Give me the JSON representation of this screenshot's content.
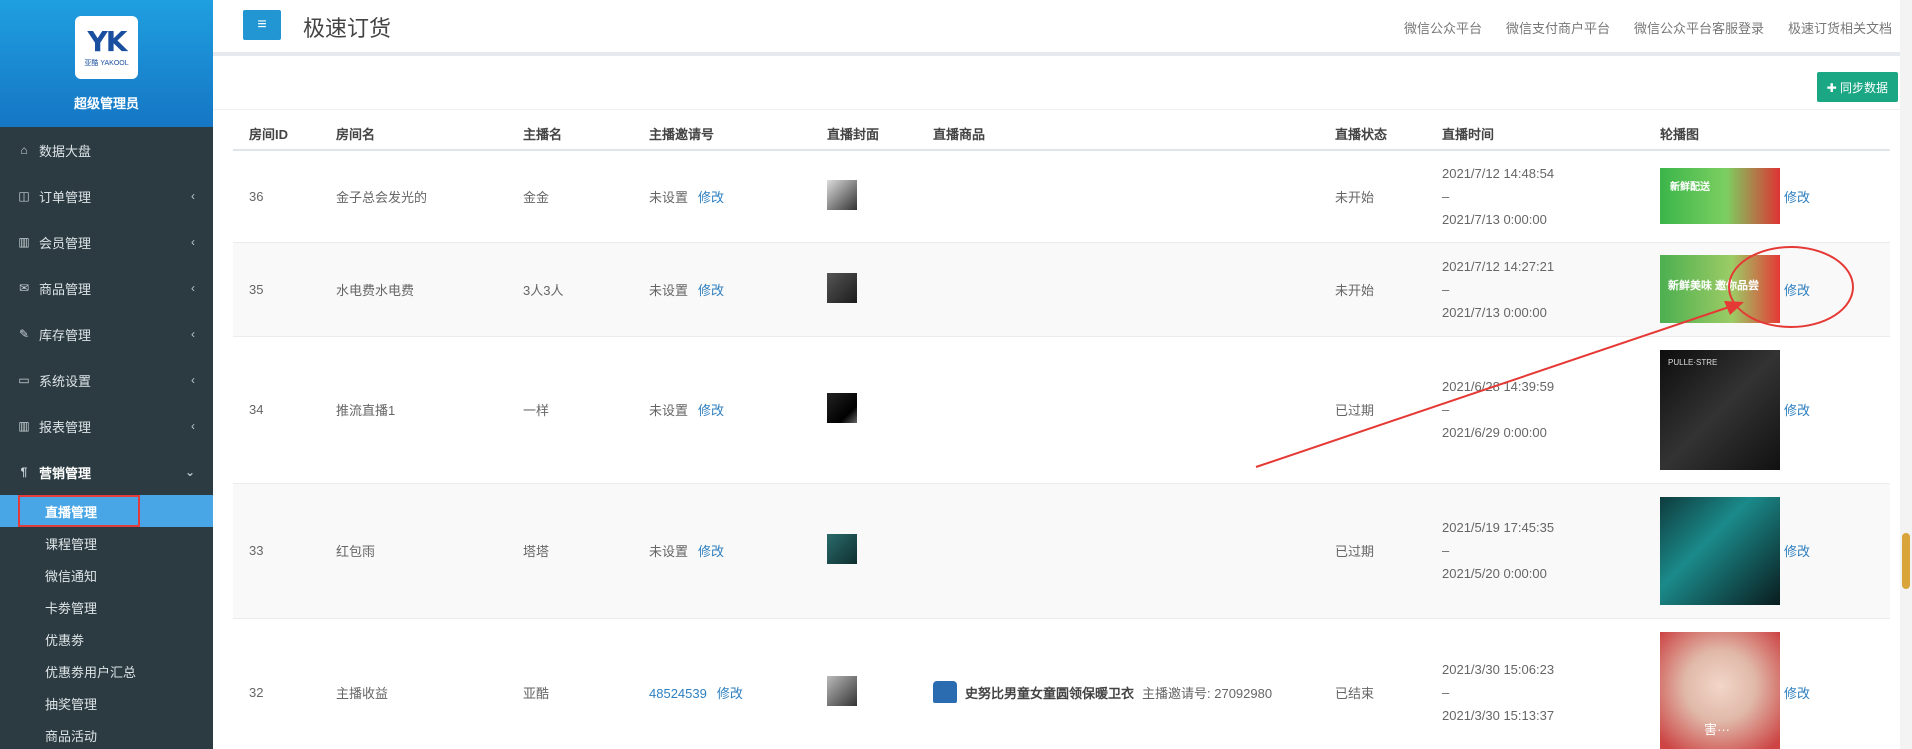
{
  "brand": {
    "logo_mark": "YK",
    "logo_sub": "亚酷 YAKOOL",
    "user": "超级管理员"
  },
  "sidebar": {
    "items": [
      {
        "label": "数据大盘",
        "icon": "dashboard-icon",
        "glyph": "⌂",
        "chevron": ""
      },
      {
        "label": "订单管理",
        "icon": "order-icon",
        "glyph": "◫",
        "chevron": "‹"
      },
      {
        "label": "会员管理",
        "icon": "bar-chart-icon",
        "glyph": "▥",
        "chevron": "‹"
      },
      {
        "label": "商品管理",
        "icon": "envelope-icon",
        "glyph": "✉",
        "chevron": "‹"
      },
      {
        "label": "库存管理",
        "icon": "edit-icon",
        "glyph": "✎",
        "chevron": "‹"
      },
      {
        "label": "系统设置",
        "icon": "monitor-icon",
        "glyph": "▭",
        "chevron": "‹"
      },
      {
        "label": "报表管理",
        "icon": "bar-chart-icon",
        "glyph": "▥",
        "chevron": "‹"
      },
      {
        "label": "营销管理",
        "icon": "cutlery-icon",
        "glyph": "¶",
        "chevron": "⌄"
      }
    ],
    "submenu": [
      "直播管理",
      "课程管理",
      "微信通知",
      "卡劵管理",
      "优惠劵",
      "优惠劵用户汇总",
      "抽奖管理",
      "商品活动"
    ]
  },
  "header": {
    "toggle_glyph": "≡",
    "title": "极速订货",
    "links": [
      "微信公众平台",
      "微信支付商户平台",
      "微信公众平台客服登录",
      "极速订货相关文档"
    ]
  },
  "toolbar": {
    "sync_label": "✚ 同步数据"
  },
  "table": {
    "headers": [
      "房间ID",
      "房间名",
      "主播名",
      "主播邀请号",
      "直播封面",
      "直播商品",
      "直播状态",
      "直播时间",
      "轮播图"
    ],
    "edit_label": "修改",
    "rows": [
      {
        "id": "36",
        "name": "金子总会发光的",
        "anchor": "金金",
        "invite": "未设置",
        "goods": "",
        "goods_note": "",
        "status": "未开始",
        "start": "2021/7/12 14:48:54",
        "sep": "–",
        "end": "2021/7/13 0:00:00",
        "banner_text": "新鲜配送"
      },
      {
        "id": "35",
        "name": "水电费水电费",
        "anchor": "3人3人",
        "invite": "未设置",
        "goods": "",
        "goods_note": "",
        "status": "未开始",
        "start": "2021/7/12 14:27:21",
        "sep": "–",
        "end": "2021/7/13 0:00:00",
        "banner_text": "新鲜美味 邀你品尝"
      },
      {
        "id": "34",
        "name": "推流直播1",
        "anchor": "一样",
        "invite": "未设置",
        "goods": "",
        "goods_note": "",
        "status": "已过期",
        "start": "2021/6/28 14:39:59",
        "sep": "–",
        "end": "2021/6/29 0:00:00",
        "banner_text": "PULLE·STRE"
      },
      {
        "id": "33",
        "name": "红包雨",
        "anchor": "塔塔",
        "invite": "未设置",
        "goods": "",
        "goods_note": "",
        "status": "已过期",
        "start": "2021/5/19 17:45:35",
        "sep": "–",
        "end": "2021/5/20 0:00:00",
        "banner_text": ""
      },
      {
        "id": "32",
        "name": "主播收益",
        "anchor": "亚酷",
        "invite": "48524539",
        "goods": "史努比男童女童圆领保暖卫衣",
        "goods_note": "主播邀请号: 27092980",
        "status": "已结束",
        "start": "2021/3/30 15:06:23",
        "sep": "–",
        "end": "2021/3/30 15:13:37",
        "banner_text": "害···"
      }
    ]
  }
}
